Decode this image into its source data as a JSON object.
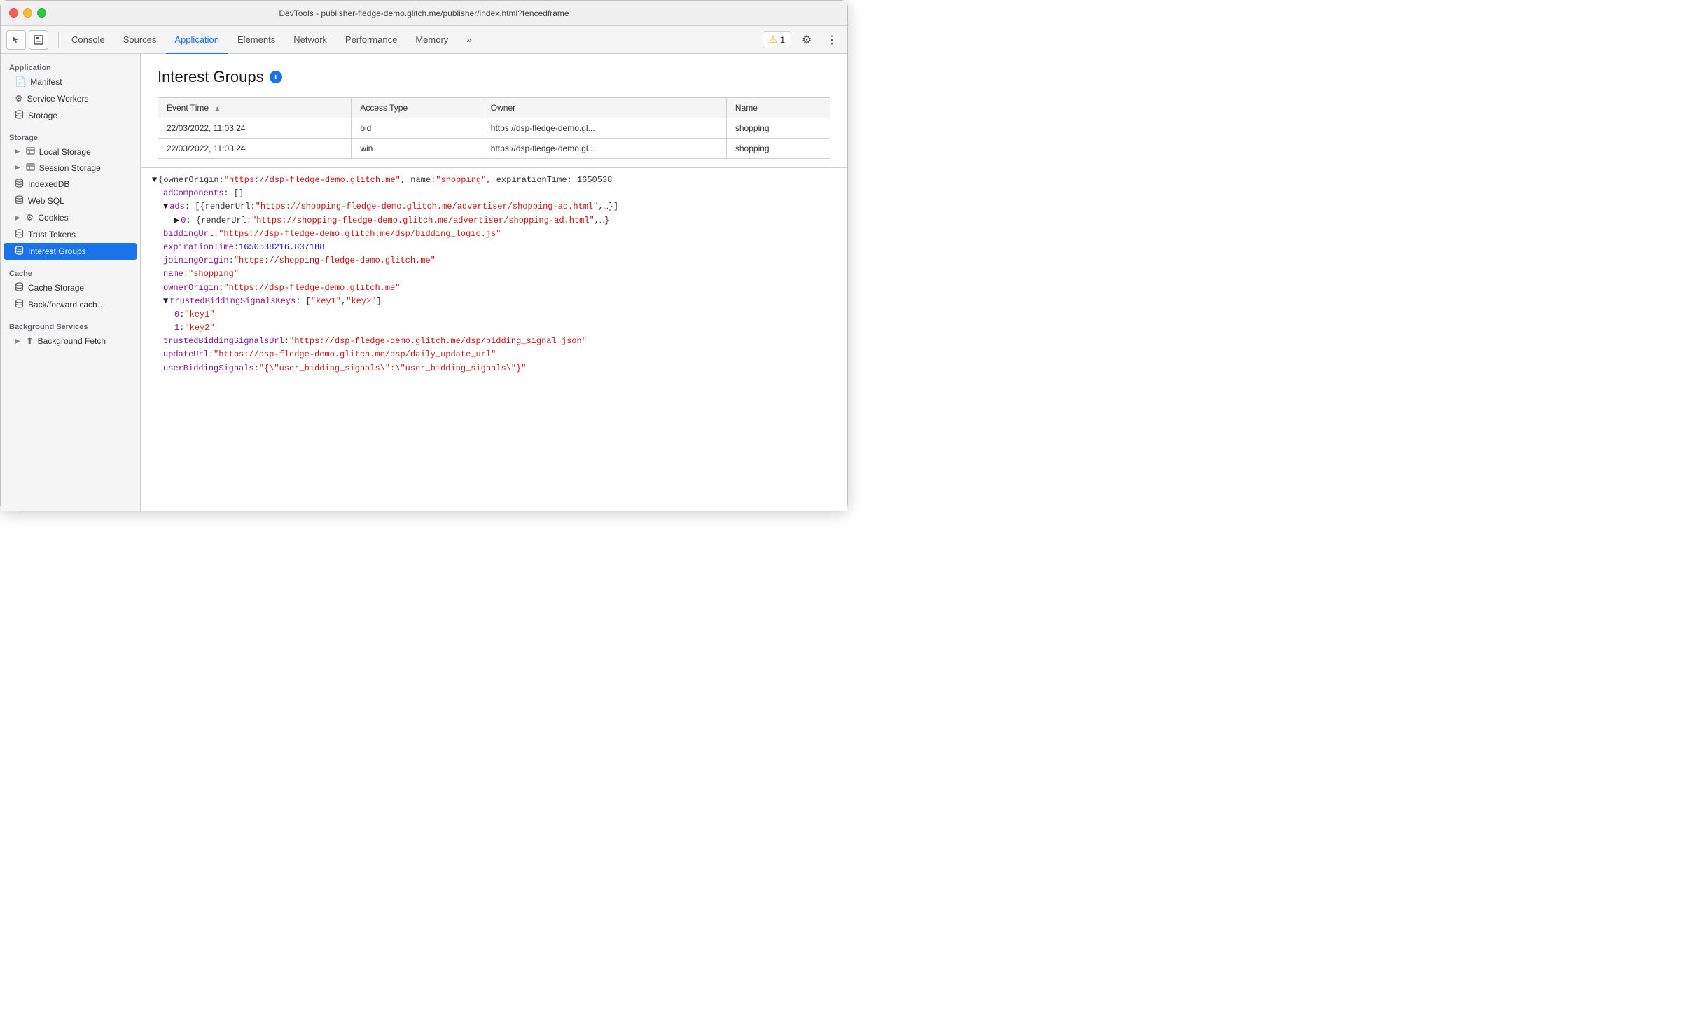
{
  "titleBar": {
    "title": "DevTools - publisher-fledge-demo.glitch.me/publisher/index.html?fencedframe"
  },
  "toolbar": {
    "tabs": [
      {
        "id": "console",
        "label": "Console",
        "active": false
      },
      {
        "id": "sources",
        "label": "Sources",
        "active": false
      },
      {
        "id": "application",
        "label": "Application",
        "active": true
      },
      {
        "id": "elements",
        "label": "Elements",
        "active": false
      },
      {
        "id": "network",
        "label": "Network",
        "active": false
      },
      {
        "id": "performance",
        "label": "Performance",
        "active": false
      },
      {
        "id": "memory",
        "label": "Memory",
        "active": false
      }
    ],
    "more_label": "»",
    "warning_count": "1",
    "settings_icon": "⚙",
    "more_icon": "⋮"
  },
  "sidebar": {
    "sections": [
      {
        "title": "Application",
        "items": [
          {
            "id": "manifest",
            "label": "Manifest",
            "icon": "📄",
            "indent": 1
          },
          {
            "id": "service-workers",
            "label": "Service Workers",
            "icon": "⚙",
            "indent": 1
          },
          {
            "id": "storage-top",
            "label": "Storage",
            "icon": "🗄",
            "indent": 1
          }
        ]
      },
      {
        "title": "Storage",
        "items": [
          {
            "id": "local-storage",
            "label": "Local Storage",
            "icon": "▶",
            "indent": 1,
            "hasArrow": true
          },
          {
            "id": "session-storage",
            "label": "Session Storage",
            "icon": "▶",
            "indent": 1,
            "hasArrow": true
          },
          {
            "id": "indexeddb",
            "label": "IndexedDB",
            "icon": "🗄",
            "indent": 1
          },
          {
            "id": "web-sql",
            "label": "Web SQL",
            "icon": "🗄",
            "indent": 1
          },
          {
            "id": "cookies",
            "label": "Cookies",
            "icon": "▶",
            "indent": 1,
            "hasArrow": true,
            "cookieIcon": true
          },
          {
            "id": "trust-tokens",
            "label": "Trust Tokens",
            "icon": "🗄",
            "indent": 1
          },
          {
            "id": "interest-groups",
            "label": "Interest Groups",
            "icon": "🗄",
            "indent": 1,
            "active": true
          }
        ]
      },
      {
        "title": "Cache",
        "items": [
          {
            "id": "cache-storage",
            "label": "Cache Storage",
            "icon": "🗄",
            "indent": 1
          },
          {
            "id": "back-forward-cache",
            "label": "Back/forward cach…",
            "icon": "🗄",
            "indent": 1
          }
        ]
      },
      {
        "title": "Background Services",
        "items": [
          {
            "id": "background-fetch",
            "label": "Background Fetch",
            "icon": "▶",
            "indent": 1,
            "hasArrow": true
          }
        ]
      }
    ]
  },
  "interestGroups": {
    "title": "Interest Groups",
    "infoIcon": "i",
    "table": {
      "columns": [
        {
          "id": "event-time",
          "label": "Event Time",
          "sortable": true
        },
        {
          "id": "access-type",
          "label": "Access Type"
        },
        {
          "id": "owner",
          "label": "Owner"
        },
        {
          "id": "name",
          "label": "Name"
        }
      ],
      "rows": [
        {
          "eventTime": "22/03/2022, 11:03:24",
          "accessType": "bid",
          "owner": "https://dsp-fledge-demo.gl...",
          "name": "shopping"
        },
        {
          "eventTime": "22/03/2022, 11:03:24",
          "accessType": "win",
          "owner": "https://dsp-fledge-demo.gl...",
          "name": "shopping"
        }
      ]
    },
    "detail": {
      "lines": [
        {
          "type": "expand-open",
          "text": "{ownerOrigin: \"https://dsp-fledge-demo.glitch.me\", name: \"shopping\", expirationTime: 1650538",
          "indent": 0
        },
        {
          "type": "key-value",
          "key": "adComponents",
          "colon": ": ",
          "value": "[]",
          "valueType": "plain",
          "indent": 1
        },
        {
          "type": "expand-open-key",
          "key": "ads",
          "colon": ": ",
          "value": "[{renderUrl: \"https://shopping-fledge-demo.glitch.me/advertiser/shopping-ad.html\",…}]",
          "indent": 1
        },
        {
          "type": "expand-open-key",
          "key": "▶ 0",
          "colon": ": ",
          "value": "{renderUrl: \"https://shopping-fledge-demo.glitch.me/advertiser/shopping-ad.html\",…}",
          "indent": 2
        },
        {
          "type": "key-value",
          "key": "biddingUrl",
          "colon": ": ",
          "value": "\"https://dsp-fledge-demo.glitch.me/dsp/bidding_logic.js\"",
          "valueType": "url",
          "indent": 1
        },
        {
          "type": "key-value",
          "key": "expirationTime",
          "colon": ": ",
          "value": "1650538216.837188",
          "valueType": "number",
          "indent": 1
        },
        {
          "type": "key-value",
          "key": "joiningOrigin",
          "colon": ": ",
          "value": "\"https://shopping-fledge-demo.glitch.me\"",
          "valueType": "url",
          "indent": 1
        },
        {
          "type": "key-value",
          "key": "name",
          "colon": ": ",
          "value": "\"shopping\"",
          "valueType": "url",
          "indent": 1
        },
        {
          "type": "key-value",
          "key": "ownerOrigin",
          "colon": ": ",
          "value": "\"https://dsp-fledge-demo.glitch.me\"",
          "valueType": "url",
          "indent": 1
        },
        {
          "type": "expand-open-key",
          "key": "trustedBiddingSignalsKeys",
          "colon": ": ",
          "value": "[\"key1\", \"key2\"]",
          "indent": 1
        },
        {
          "type": "key-value",
          "key": "0",
          "colon": ": ",
          "value": "\"key1\"",
          "valueType": "url",
          "indent": 2
        },
        {
          "type": "key-value",
          "key": "1",
          "colon": ": ",
          "value": "\"key2\"",
          "valueType": "url",
          "indent": 2
        },
        {
          "type": "key-value",
          "key": "trustedBiddingSignalsUrl",
          "colon": ": ",
          "value": "\"https://dsp-fledge-demo.glitch.me/dsp/bidding_signal.json\"",
          "valueType": "url",
          "indent": 1
        },
        {
          "type": "key-value",
          "key": "updateUrl",
          "colon": ": ",
          "value": "\"https://dsp-fledge-demo.glitch.me/dsp/daily_update_url\"",
          "valueType": "url",
          "indent": 1
        },
        {
          "type": "key-value",
          "key": "userBiddingSignals",
          "colon": ": ",
          "value": "\"{\\\"user_bidding_signals\\\":\\\"user_bidding_signals\\\"}\"",
          "valueType": "url",
          "indent": 1
        }
      ]
    }
  },
  "colors": {
    "active_tab": "#1a73e8",
    "active_sidebar": "#1a73e8",
    "key_color": "#881391",
    "string_color": "#c41a16",
    "number_color": "#1c00cf"
  }
}
